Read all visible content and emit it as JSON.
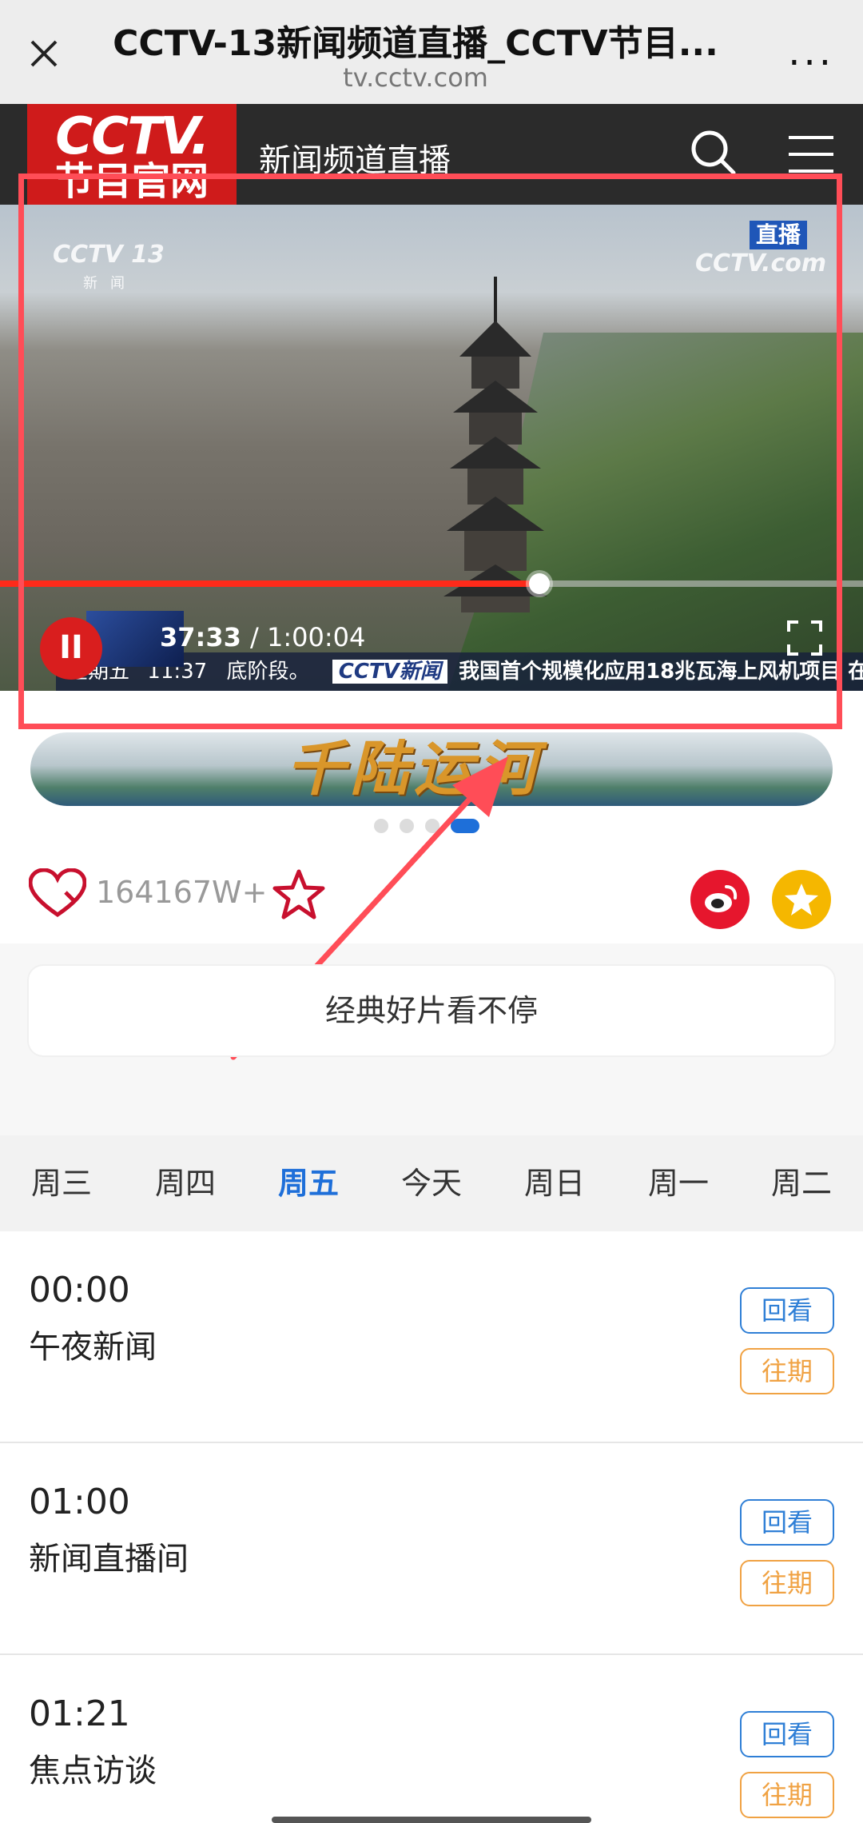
{
  "browser": {
    "title": "CCTV-13新闻频道直播_CCTV节目...",
    "url": "tv.cctv.com",
    "more": "..."
  },
  "site_header": {
    "logo_line1": "CCTV.",
    "logo_line2": "节目官网",
    "channel_name": "新闻频道直播"
  },
  "player": {
    "channel_logo": "CCTV 13",
    "channel_logo_sub": "新闻",
    "live_badge": "直播",
    "watermark": "CCTV.com",
    "current_time": "37:33",
    "duration": "/ 1:00:04",
    "progress_fraction": 0.625,
    "ticker": {
      "day": "星期五",
      "clock": "11:37",
      "text": "底阶段。",
      "tag": "CCTV新闻",
      "headline": "我国首个规模化应用18兆瓦海上风机项目 在"
    },
    "pause_label": "II"
  },
  "banner": {
    "text": "千陆运河",
    "dots": 4,
    "active_dot": 3
  },
  "actions": {
    "like_count": "164167W+"
  },
  "promo": {
    "text": "经典好片看不停"
  },
  "day_tabs": [
    {
      "label": "周三",
      "active": false
    },
    {
      "label": "周四",
      "active": false
    },
    {
      "label": "周五",
      "active": true
    },
    {
      "label": "今天",
      "active": false
    },
    {
      "label": "周日",
      "active": false
    },
    {
      "label": "周一",
      "active": false
    },
    {
      "label": "周二",
      "active": false
    }
  ],
  "programs": [
    {
      "time": "00:00",
      "name": "午夜新闻",
      "replay": "回看",
      "past": "往期"
    },
    {
      "time": "01:00",
      "name": "新闻直播间",
      "replay": "回看",
      "past": "往期"
    },
    {
      "time": "01:21",
      "name": "焦点访谈",
      "replay": "回看",
      "past": "往期"
    }
  ],
  "colors": {
    "accent_blue": "#1e6fd9",
    "brand_red": "#cf1b1b",
    "annotation_red": "#ff4d57",
    "past_orange": "#f0a243"
  }
}
